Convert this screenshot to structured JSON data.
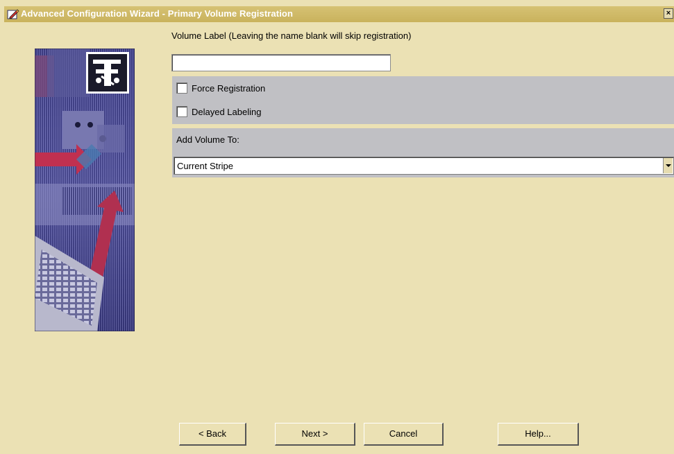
{
  "window": {
    "title": "Advanced Configuration Wizard - Primary Volume Registration",
    "close_label": "×"
  },
  "volume": {
    "label_text": "Volume Label (Leaving the name blank will skip registration)",
    "value": "",
    "placeholder": ""
  },
  "options": {
    "force_registration": {
      "label": "Force Registration",
      "checked": false
    },
    "delayed_labeling": {
      "label": "Delayed Labeling",
      "checked": false
    }
  },
  "add_volume": {
    "label": "Add Volume To:",
    "selected": "Current Stripe"
  },
  "buttons": {
    "back": "< Back",
    "next": "Next >",
    "cancel": "Cancel",
    "help": "Help..."
  },
  "colors": {
    "window_bg": "#ebe1b4",
    "titlebar": "#c9b25c",
    "panel_gray": "#c0c0c4"
  },
  "icons": {
    "title": "wizard-pencil-icon",
    "close": "close-icon",
    "dropdown": "chevron-down-icon"
  }
}
